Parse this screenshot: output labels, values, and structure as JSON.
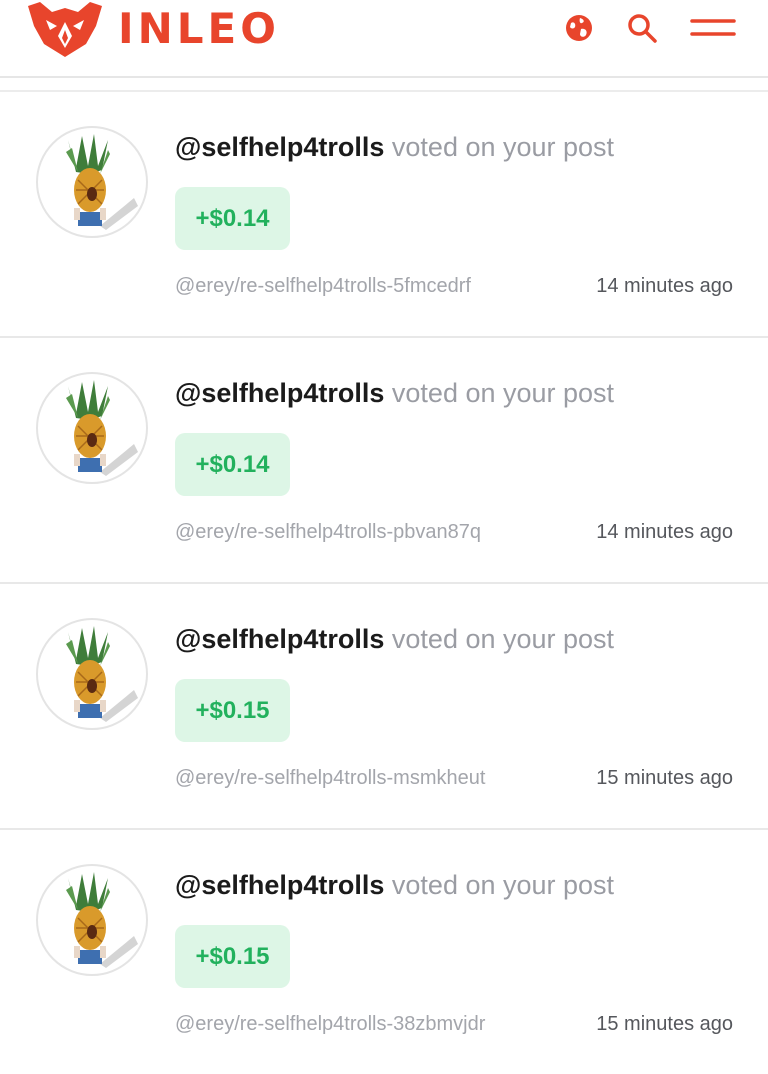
{
  "header": {
    "brand": "INLEO",
    "brand_color": "#e8452c",
    "icons": [
      "globe-icon",
      "search-icon",
      "menu-icon"
    ]
  },
  "colors": {
    "accent": "#e8452c",
    "amount_text": "#22b15d",
    "amount_bg": "#ddf6e6",
    "muted_text": "#9a9ca3"
  },
  "notifications": [
    {
      "user": "@selfhelp4trolls",
      "action": "voted on your post",
      "amount": "+$0.14",
      "permlink": "@erey/re-selfhelp4trolls-5fmcedrf",
      "time": "14 minutes ago"
    },
    {
      "user": "@selfhelp4trolls",
      "action": "voted on your post",
      "amount": "+$0.14",
      "permlink": "@erey/re-selfhelp4trolls-pbvan87q",
      "time": "14 minutes ago"
    },
    {
      "user": "@selfhelp4trolls",
      "action": "voted on your post",
      "amount": "+$0.15",
      "permlink": "@erey/re-selfhelp4trolls-msmkheut",
      "time": "15 minutes ago"
    },
    {
      "user": "@selfhelp4trolls",
      "action": "voted on your post",
      "amount": "+$0.15",
      "permlink": "@erey/re-selfhelp4trolls-38zbmvjdr",
      "time": "15 minutes ago"
    }
  ]
}
